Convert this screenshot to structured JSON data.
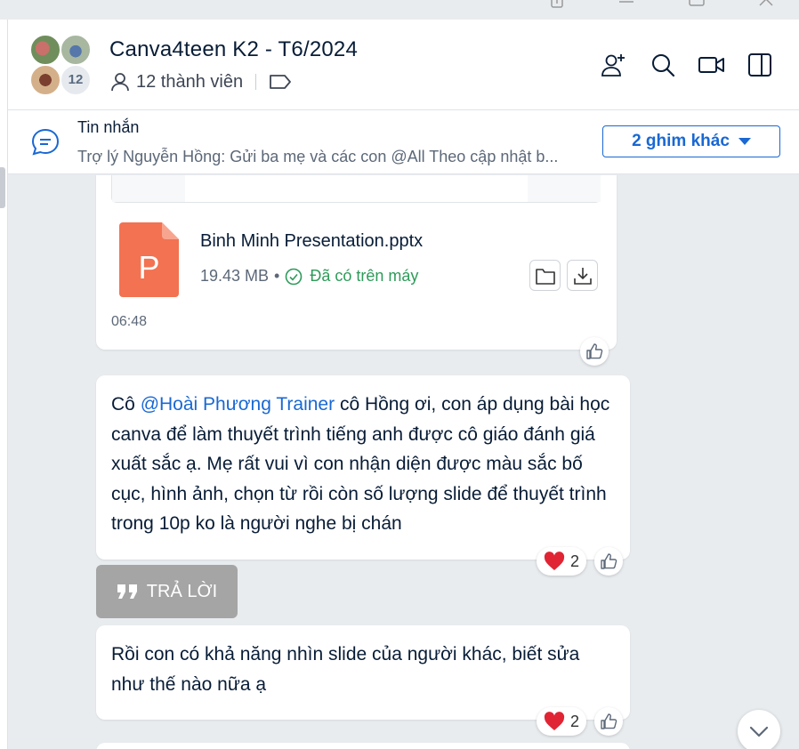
{
  "window": {
    "controls": [
      "restore-icon",
      "minimize-icon",
      "maximize-icon",
      "close-icon"
    ]
  },
  "header": {
    "title": "Canva4teen K2 - T6/2024",
    "members_label": "12 thành viên",
    "avatar_count": "12",
    "icons": [
      "add-member-icon",
      "search-icon",
      "video-call-icon",
      "sidebar-toggle-icon"
    ]
  },
  "pinned": {
    "title": "Tin nhắn",
    "preview": "Trợ lý Nguyễn Hồng: Gửi ba mẹ và các con @All Theo cập nhật b...",
    "more_pins": "2 ghim khác"
  },
  "messages": {
    "file": {
      "name": "Binh Minh Presentation.pptx",
      "size": "19.43 MB",
      "dot": "•",
      "status": "Đã có trên máy",
      "time": "06:48",
      "icon_letter": "P"
    },
    "msg1": {
      "prefix": "Cô ",
      "mention": "@Hoài Phương Trainer",
      "rest": " cô Hồng ơi, con áp dụng bài học canva để làm thuyết trình tiếng anh được cô giáo đánh giá xuất sắc ạ. Mẹ rất vui vì con nhận diện được màu sắc bố cục, hình ảnh, chọn từ rồi còn số lượng slide để thuyết trình trong 10p ko là người nghe bị chán",
      "reaction_count": "2"
    },
    "reply_label": "TRẢ LỜI",
    "msg2": {
      "text": "Rồi con có khả năng nhìn slide của người khác, biết sửa như thế nào nữa ạ",
      "reaction_count": "2"
    }
  },
  "colors": {
    "accent": "#1968d3",
    "file_icon": "#f27251",
    "status_green": "#2e9b5a",
    "heart": "#e02434"
  }
}
